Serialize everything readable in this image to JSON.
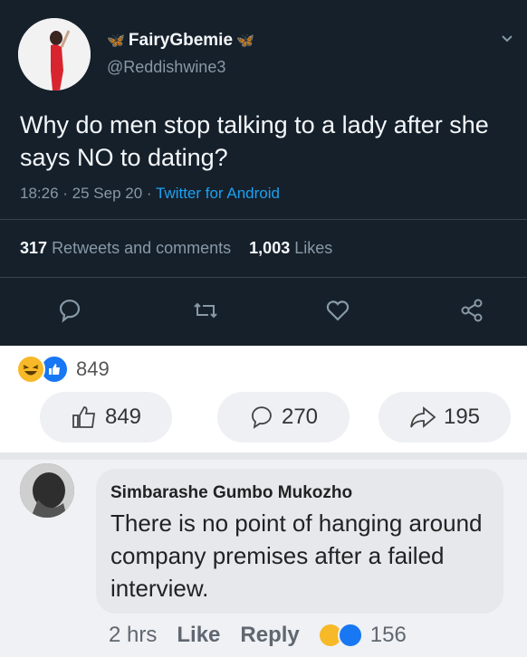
{
  "tweet": {
    "display_name": "FairyGbemie",
    "handle": "@Reddishwine3",
    "text": "Why do men stop talking to a lady after she says NO to dating?",
    "time": "18:26 · 25 Sep 20 ·",
    "source": "Twitter for Android",
    "retweets_count": "317",
    "retweets_label": "Retweets and comments",
    "likes_count": "1,003",
    "likes_label": "Likes"
  },
  "post": {
    "reactions_count": "849",
    "likes_btn": "849",
    "comments_btn": "270",
    "shares_btn": "195"
  },
  "comment": {
    "author": "Simbarashe Gumbo Mukozho",
    "text": "There is no point of hanging around company premises after a failed interview.",
    "time": "2 hrs",
    "like_label": "Like",
    "reply_label": "Reply",
    "reactions_count": "156"
  },
  "colors": {
    "twitter_bg": "#15202b",
    "twitter_blue": "#1da1f2",
    "fb_blue": "#1877f2",
    "haha_yellow": "#f7b928"
  }
}
